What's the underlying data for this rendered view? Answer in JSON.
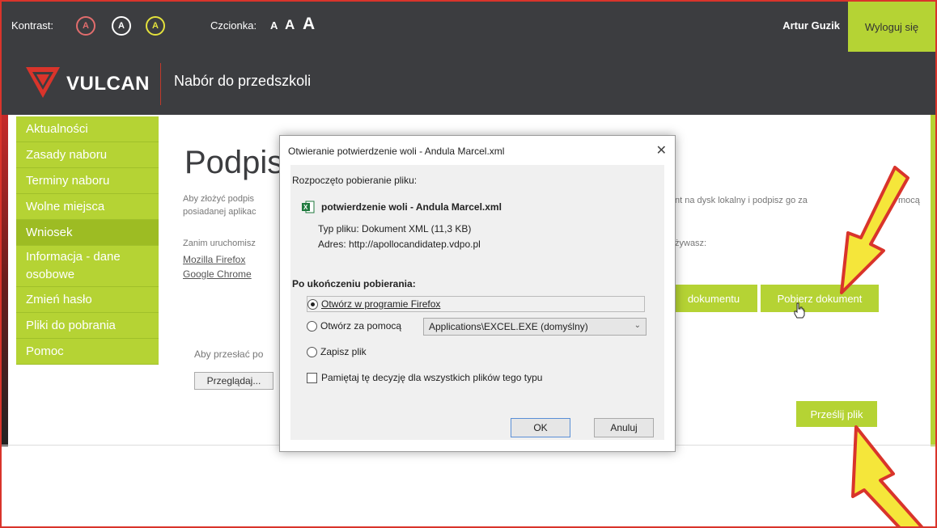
{
  "topbar": {
    "kontrast_label": "Kontrast:",
    "kontrast_buttons": [
      "A",
      "A",
      "A"
    ],
    "font_label": "Czcionka:",
    "font_sizes": [
      "A",
      "A",
      "A"
    ],
    "user": "Artur Guzik",
    "logout": "Wyloguj się"
  },
  "header": {
    "logo": "VULCAN",
    "app_title": "Nabór do przedszkoli"
  },
  "sidebar": {
    "items": [
      {
        "label": "Aktualności"
      },
      {
        "label": "Zasady naboru"
      },
      {
        "label": "Terminy naboru"
      },
      {
        "label": "Wolne miejsca"
      },
      {
        "label": "Wniosek"
      },
      {
        "label": "Informacja - dane osobowe"
      },
      {
        "label": "Zmień hasło"
      },
      {
        "label": "Pliki do pobrania"
      },
      {
        "label": "Pomoc"
      }
    ]
  },
  "main": {
    "title": "Podpis",
    "para1a": "Aby złożyć podpis",
    "para1b": "posiadanej aplikac",
    "para1_right": "nt na dysk lokalny i podpisz go za",
    "para1_right2": "mocą",
    "para2": "Zanim uruchomisz",
    "para2_right": "żywasz:",
    "link_firefox": "Mozilla Firefox",
    "link_chrome": "Google Chrome",
    "btn_view": "dokumentu",
    "btn_download": "Pobierz dokument",
    "upload_text": "Aby przesłać po",
    "browse": "Przeglądaj...",
    "btn_send": "Prześlij plik"
  },
  "dialog": {
    "title": "Otwieranie potwierdzenie woli - Andula Marcel.xml",
    "started": "Rozpoczęto pobieranie pliku:",
    "filename": "potwierdzenie woli - Andula Marcel.xml",
    "filetype": "Typ pliku: Dokument XML (11,3 KB)",
    "address": "Adres: http://apollocandidatep.vdpo.pl",
    "after_label": "Po ukończeniu pobierania:",
    "opt_open": "Otwórz w programie Firefox",
    "opt_openwith": "Otwórz za pomocą",
    "openwith_value": "Applications\\EXCEL.EXE (domyślny)",
    "opt_save": "Zapisz plik",
    "remember": "Pamiętaj tę decyzję dla wszystkich plików tego typu",
    "ok": "OK",
    "cancel": "Anuluj"
  },
  "colors": {
    "accent": "#b5d334",
    "dark": "#3c3d40",
    "arrow_fill": "#f5e63a",
    "arrow_stroke": "#d9342b"
  }
}
